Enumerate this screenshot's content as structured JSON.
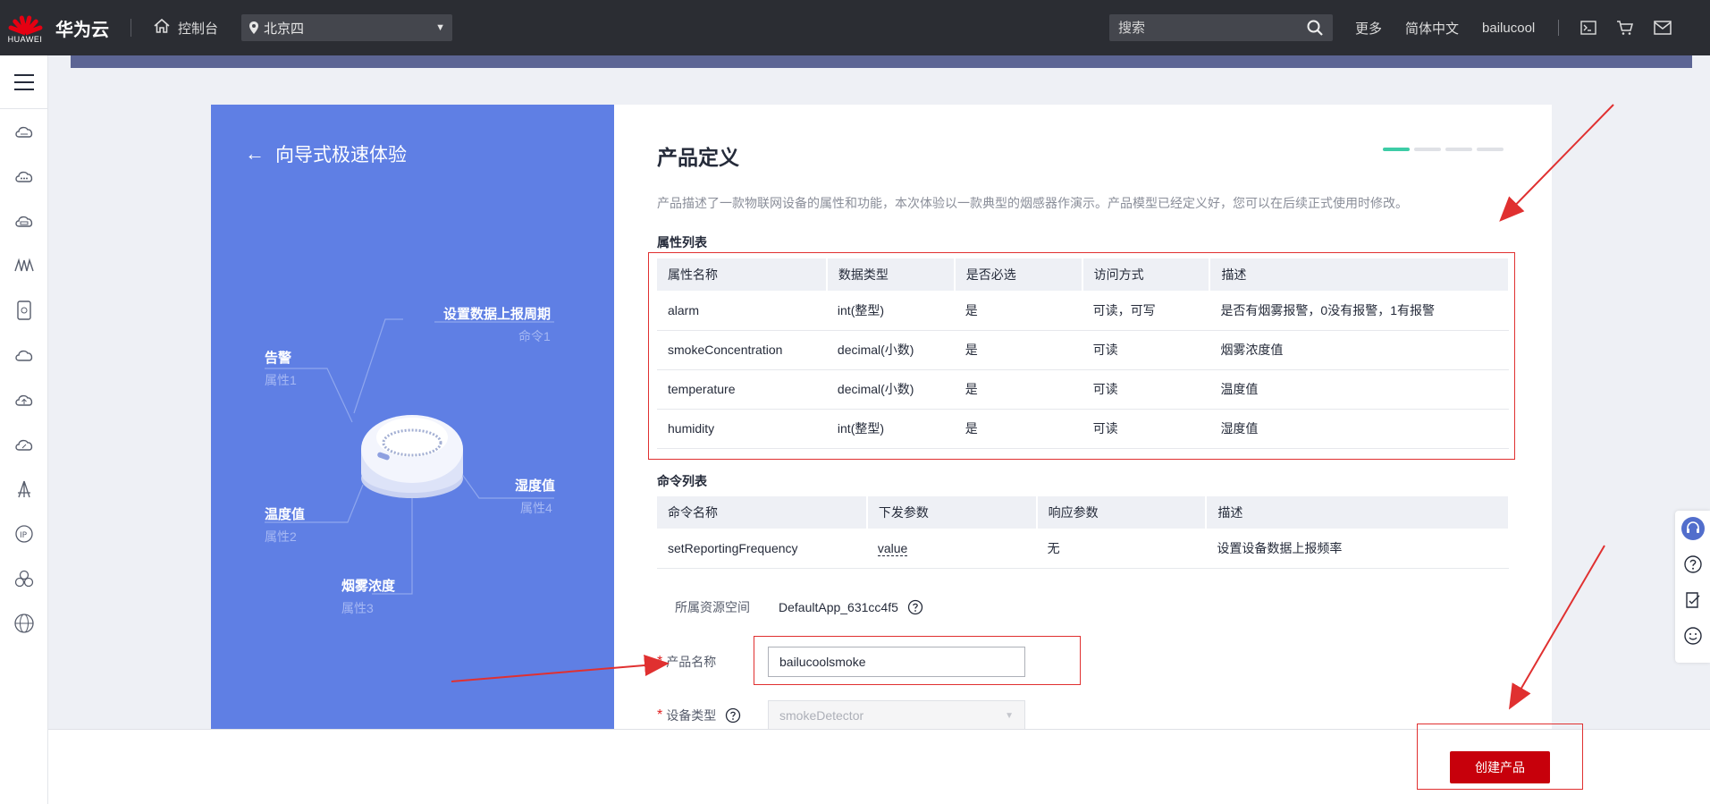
{
  "topbar": {
    "logo_text": "HUAWEI",
    "brand": "华为云",
    "console": "控制台",
    "region": "北京四",
    "search_placeholder": "搜索",
    "more": "更多",
    "language": "简体中文",
    "username": "bailucool"
  },
  "guide": {
    "back_title": "向导式极速体验",
    "diagram": {
      "cmd_label": "设置数据上报周期",
      "cmd_sub": "命令1",
      "alarm_label": "告警",
      "alarm_sub": "属性1",
      "temp_label": "温度值",
      "temp_sub": "属性2",
      "smoke_label": "烟雾浓度",
      "smoke_sub": "属性3",
      "humidity_label": "湿度值",
      "humidity_sub": "属性4"
    }
  },
  "product": {
    "title": "产品定义",
    "description": "产品描述了一款物联网设备的属性和功能，本次体验以一款典型的烟感器作演示。产品模型已经定义好，您可以在后续正式使用时修改。",
    "attr_section": "属性列表",
    "attr_headers": [
      "属性名称",
      "数据类型",
      "是否必选",
      "访问方式",
      "描述"
    ],
    "attr_rows": [
      [
        "alarm",
        "int(整型)",
        "是",
        "可读，可写",
        "是否有烟雾报警，0没有报警，1有报警"
      ],
      [
        "smokeConcentration",
        "decimal(小数)",
        "是",
        "可读",
        "烟雾浓度值"
      ],
      [
        "temperature",
        "decimal(小数)",
        "是",
        "可读",
        "温度值"
      ],
      [
        "humidity",
        "int(整型)",
        "是",
        "可读",
        "湿度值"
      ]
    ],
    "cmd_section": "命令列表",
    "cmd_headers": [
      "命令名称",
      "下发参数",
      "响应参数",
      "描述"
    ],
    "cmd_rows": [
      [
        "setReportingFrequency",
        "value",
        "无",
        "设置设备数据上报频率"
      ]
    ],
    "resource_space_label": "所属资源空间",
    "resource_space_value": "DefaultApp_631cc4f5",
    "product_name_label": "产品名称",
    "product_name_value": "bailucoolsmoke",
    "device_type_label": "设备类型",
    "device_type_value": "smokeDetector"
  },
  "footer": {
    "create_button": "创建产品"
  },
  "colors": {
    "topbar_bg": "#2b2d33",
    "guide_blue": "#5f7fe4",
    "brand_red": "#c7000b",
    "step_active": "#3dcca6",
    "annotation_red": "#e03030"
  }
}
